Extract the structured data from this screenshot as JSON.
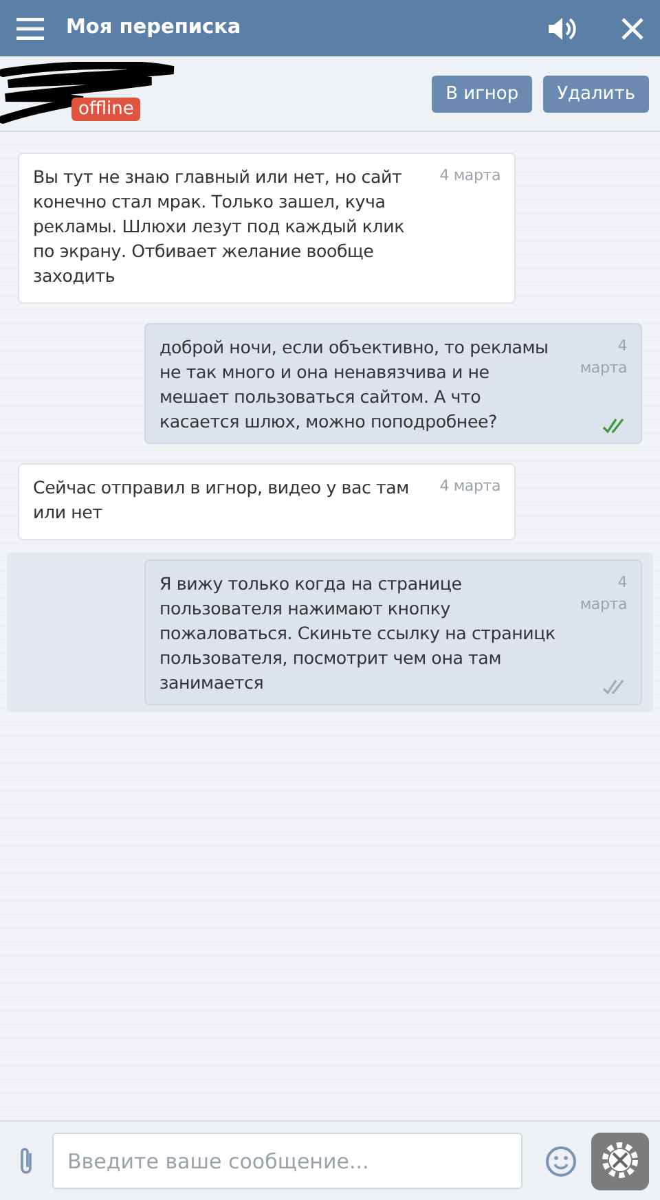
{
  "header": {
    "title": "Моя переписка"
  },
  "contact": {
    "status": "offline",
    "redacted": true
  },
  "actions": [
    "В игнор",
    "Удалить"
  ],
  "messages": [
    {
      "kind": "in",
      "text": "Вы тут не знаю главный или нет, но сайт конечно стал мрак. Только зашел, куча рекламы. Шлюхи лезут под каждый клик по экрану. Отбивает желание вообще заходить",
      "time": "4 марта",
      "highlighted": false
    },
    {
      "kind": "out",
      "text": "доброй ночи, если объективно, то рекламы не так много и она ненавязчива и не мешает пользоваться сайтом. А что касается шлюх, можно поподробнее?",
      "time": "4 марта",
      "read": true,
      "highlighted": false
    },
    {
      "kind": "in",
      "text": "Сейчас отправил в игнор, видео у вас там или нет",
      "time": "4 марта",
      "highlighted": false
    },
    {
      "kind": "out",
      "text": "Я вижу только когда на странице пользователя нажимают кнопку пожаловаться. Скиньте ссылку на страницк пользователя, посмотрит чем она там занимается",
      "time": "4 марта",
      "read": false,
      "highlighted": true
    }
  ],
  "composer": {
    "placeholder": "Введите ваше сообщение..."
  }
}
